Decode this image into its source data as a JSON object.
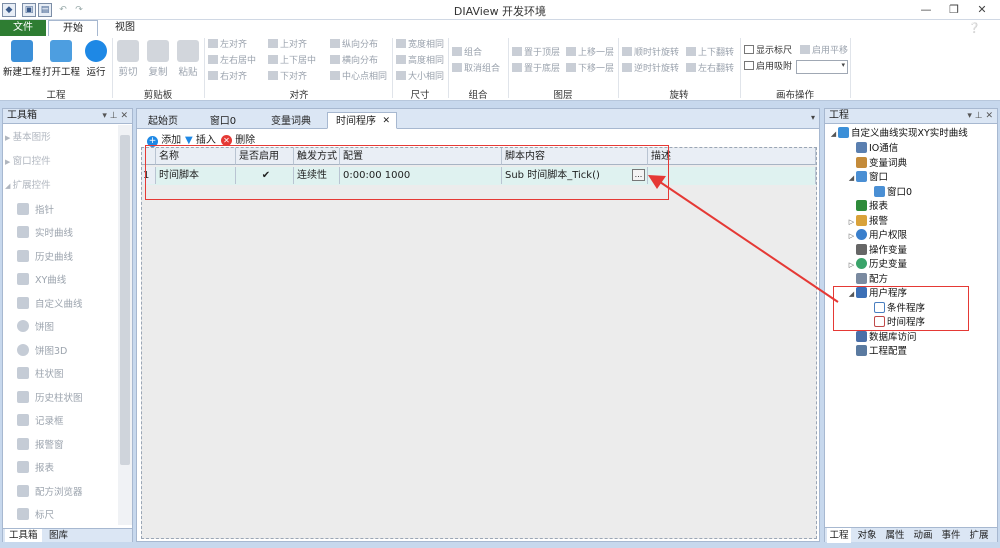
{
  "app": {
    "title": "DIAView 开发环境"
  },
  "menu_tabs": [
    {
      "label": "文件"
    },
    {
      "label": "开始"
    },
    {
      "label": "视图"
    }
  ],
  "ribbon": {
    "groups": [
      "工程",
      "剪贴板",
      "对齐",
      "尺寸",
      "组合",
      "图层",
      "旋转",
      "画布操作"
    ],
    "project": [
      "新建工程",
      "打开工程",
      "运行"
    ],
    "clipboard": [
      "剪切",
      "复制",
      "粘贴"
    ],
    "align": [
      "左对齐",
      "左右居中",
      "右对齐",
      "上对齐",
      "上下居中",
      "下对齐",
      "纵向分布",
      "横向分布",
      "中心点相同"
    ],
    "size": [
      "宽度相同",
      "高度相同",
      "大小相同"
    ],
    "combine": [
      "组合",
      "取消组合"
    ],
    "layer": [
      "置于顶层",
      "上移一层",
      "置于底层",
      "下移一层"
    ],
    "rotate": [
      "顺时针旋转",
      "上下翻转",
      "逆时针旋转",
      "左右翻转"
    ],
    "canvas": [
      "显示标尺",
      "启用平移",
      "启用吸附"
    ]
  },
  "toolbox": {
    "title": "工具箱",
    "items": [
      "基本图形",
      "窗口控件",
      "扩展控件",
      "指针",
      "实时曲线",
      "历史曲线",
      "XY曲线",
      "自定义曲线",
      "饼图",
      "饼图3D",
      "柱状图",
      "历史柱状图",
      "记录框",
      "报警窗",
      "报表",
      "配方浏览器",
      "标尺"
    ],
    "bottom_tabs": [
      "工具箱",
      "图库"
    ]
  },
  "doc_tabs": [
    "起始页",
    "窗口0",
    "变量词典",
    "时间程序"
  ],
  "doc_toolbar": [
    "添加",
    "插入",
    "删除"
  ],
  "grid": {
    "columns": [
      "名称",
      "是否启用",
      "触发方式",
      "配置",
      "脚本内容",
      "描述"
    ],
    "rows": [
      {
        "index": "1",
        "name": "时间脚本",
        "enabled": "✔",
        "trigger": "连续性",
        "config": "0:00:00 1000",
        "script": "Sub 时间脚本_Tick()",
        "desc": "",
        "btn": "..."
      }
    ]
  },
  "project_panel": {
    "title": "工程",
    "tree": [
      "自定义曲线实现XY实时曲线",
      "IO通信",
      "变量词典",
      "窗口",
      "窗口0",
      "报表",
      "报警",
      "用户权限",
      "操作变量",
      "历史变量",
      "配方",
      "用户程序",
      "条件程序",
      "时间程序",
      "数据库访问",
      "工程配置"
    ],
    "bottom_tabs": [
      "工程",
      "对象",
      "属性",
      "动画",
      "事件",
      "扩展"
    ]
  },
  "colors": {
    "accent": "#2e7d32",
    "highlight": "#e53935",
    "ribbon_bg": "#ffffff",
    "frame": "#c7d8ed"
  }
}
